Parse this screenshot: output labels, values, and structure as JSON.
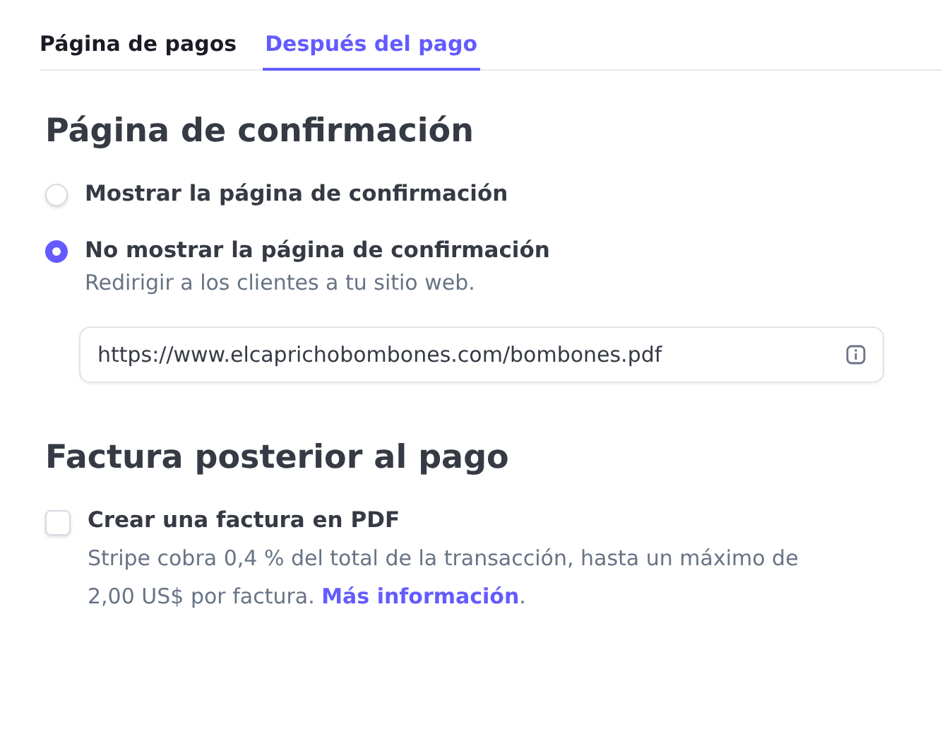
{
  "tabs": [
    {
      "label": "Página de pagos",
      "selected": false
    },
    {
      "label": "Después del pago",
      "selected": true
    }
  ],
  "confirmation": {
    "title": "Página de confirmación",
    "options": [
      {
        "label": "Mostrar la página de confirmación",
        "selected": false
      },
      {
        "label": "No mostrar la página de confirmación",
        "selected": true,
        "description": "Redirigir a los clientes a tu sitio web.",
        "url_field": {
          "value": "https://www.elcaprichobombones.com/bombones.pdf"
        }
      }
    ]
  },
  "invoice": {
    "title": "Factura posterior al pago",
    "checkbox": {
      "label": "Crear una factura en PDF",
      "checked": false
    },
    "description": "Stripe cobra 0,4 % del total de la transacción, hasta un máximo de 2,00 US$ por factura. ",
    "link": "Más información",
    "after_link": "."
  }
}
